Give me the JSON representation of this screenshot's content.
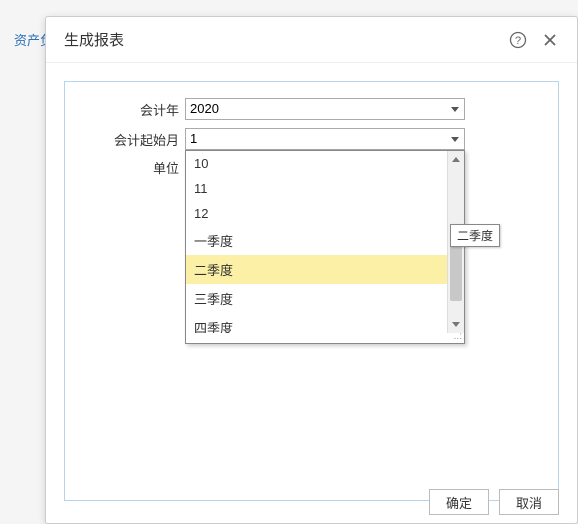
{
  "background": {
    "tab_label": "资产负"
  },
  "modal": {
    "title": "生成报表",
    "help_icon": "help-icon",
    "close_icon": "close-icon"
  },
  "form": {
    "year": {
      "label": "会计年",
      "value": "2020"
    },
    "start_month": {
      "label": "会计起始月",
      "value": "1"
    },
    "unit": {
      "label": "单位",
      "value": ""
    }
  },
  "dropdown": {
    "items": [
      "10",
      "11",
      "12",
      "一季度",
      "二季度",
      "三季度",
      "四季度"
    ],
    "highlighted_index": 4,
    "tooltip": "二季度"
  },
  "footer": {
    "ok_label": "确定",
    "cancel_label": "取消"
  }
}
